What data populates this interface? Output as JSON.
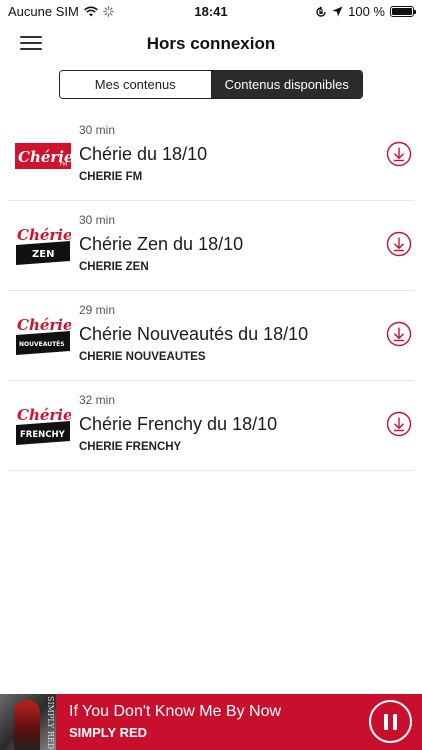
{
  "status_bar": {
    "carrier": "Aucune SIM",
    "time": "18:41",
    "battery_percent": "100 %",
    "battery_level": 1.0
  },
  "header": {
    "title": "Hors connexion",
    "menu_icon": "hamburger-menu-icon"
  },
  "tabs": [
    {
      "label": "Mes contenus",
      "selected": false
    },
    {
      "label": "Contenus disponibles",
      "selected": true
    }
  ],
  "episodes": [
    {
      "duration": "30 min",
      "title": "Chérie du 18/10",
      "station": "CHERIE FM",
      "logo": {
        "wordmark": "Chérie",
        "tag": "FM",
        "style": "red-bar"
      }
    },
    {
      "duration": "30 min",
      "title": "Chérie Zen du 18/10",
      "station": "CHERIE ZEN",
      "logo": {
        "wordmark": "Chérie",
        "tag": "ZEN",
        "style": "black-bar"
      }
    },
    {
      "duration": "29 min",
      "title": "Chérie Nouveautés du 18/10",
      "station": "CHERIE NOUVEAUTES",
      "logo": {
        "wordmark": "Chérie",
        "tag": "NOUVEAUTÉS",
        "style": "black-bar"
      }
    },
    {
      "duration": "32 min",
      "title": "Chérie Frenchy du 18/10",
      "station": "CHERIE FRENCHY",
      "logo": {
        "wordmark": "Chérie",
        "tag": "FRENCHY",
        "style": "black-bar"
      }
    }
  ],
  "player": {
    "track_title": "If You Don't Know Me By Now",
    "artist": "SIMPLY RED",
    "cover_text": "SIMPLY RED",
    "state": "playing",
    "pause_icon": "pause-icon"
  },
  "colors": {
    "brand_red": "#c8102e",
    "download_icon": "#c8102e",
    "segment_selected": "#2b2b2b"
  }
}
